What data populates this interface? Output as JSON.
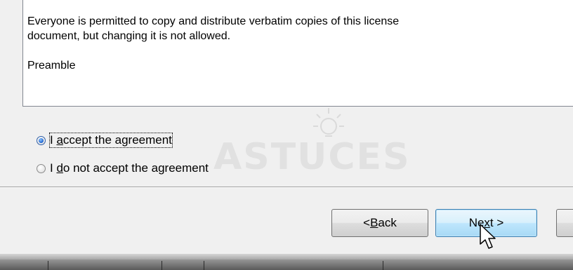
{
  "license": {
    "lines": [
      "Everyone is permitted to copy and distribute verbatim copies of this license",
      "document, but changing it is not allowed."
    ],
    "preamble": "Preamble"
  },
  "watermark": {
    "text": "ASTUCES"
  },
  "agreement": {
    "accept": {
      "prefix": "I ",
      "mnemonic": "a",
      "rest": "ccept the agreement",
      "selected": true
    },
    "decline": {
      "prefix": "I ",
      "mnemonic": "d",
      "rest": "o not accept the agreement",
      "selected": false
    }
  },
  "buttons": {
    "back": {
      "prefix": "< ",
      "mnemonic": "B",
      "rest": "ack"
    },
    "next": {
      "prefix": "Ne",
      "mnemonic": "x",
      "rest": "t >"
    }
  },
  "colors": {
    "accent": "#2a6fd6",
    "next_border": "#3c7fb1"
  },
  "icons": {
    "cursor": "arrow-cursor-icon",
    "watermark": "lightbulb-icon"
  }
}
